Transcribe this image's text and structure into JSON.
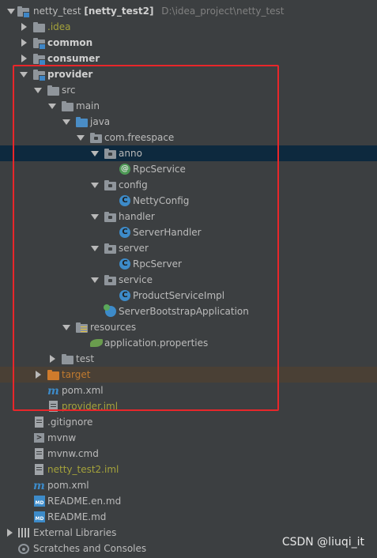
{
  "project": {
    "name": "netty_test",
    "module_tag": "[netty_test2]",
    "path": "D:\\idea_project\\netty_test"
  },
  "items": {
    "idea": ".idea",
    "common": "common",
    "consumer": "consumer",
    "provider": "provider",
    "src": "src",
    "main": "main",
    "java": "java",
    "package": "com.freespace",
    "anno": "anno",
    "rpc_service": "RpcService",
    "config": "config",
    "netty_config": "NettyConfig",
    "handler": "handler",
    "server_handler": "ServerHandler",
    "server": "server",
    "rpc_server": "RpcServer",
    "service": "service",
    "product_service_impl": "ProductServiceImpl",
    "server_bootstrap": "ServerBootstrapApplication",
    "resources": "resources",
    "application_properties": "application.properties",
    "test": "test",
    "target": "target",
    "pom_provider": "pom.xml",
    "provider_iml": "provider.iml",
    "gitignore": ".gitignore",
    "mvnw": "mvnw",
    "mvnw_cmd": "mvnw.cmd",
    "netty_test2_iml": "netty_test2.iml",
    "pom_root": "pom.xml",
    "readme_en": "README.en.md",
    "readme": "README.md",
    "external_libraries": "External Libraries",
    "scratches": "Scratches and Consoles"
  },
  "icons": {
    "annotation_letter": "@",
    "class_letter": "C",
    "maven_letter": "m",
    "markdown_letter": "MD",
    "terminal_letter": ">"
  },
  "watermark": "CSDN @liuqi_it",
  "colors": {
    "background": "#3c3f41",
    "selection": "#0d293e",
    "highlight_border": "#e8262a",
    "excluded_text": "#c07a2f",
    "iml_text": "#a4a23b"
  }
}
